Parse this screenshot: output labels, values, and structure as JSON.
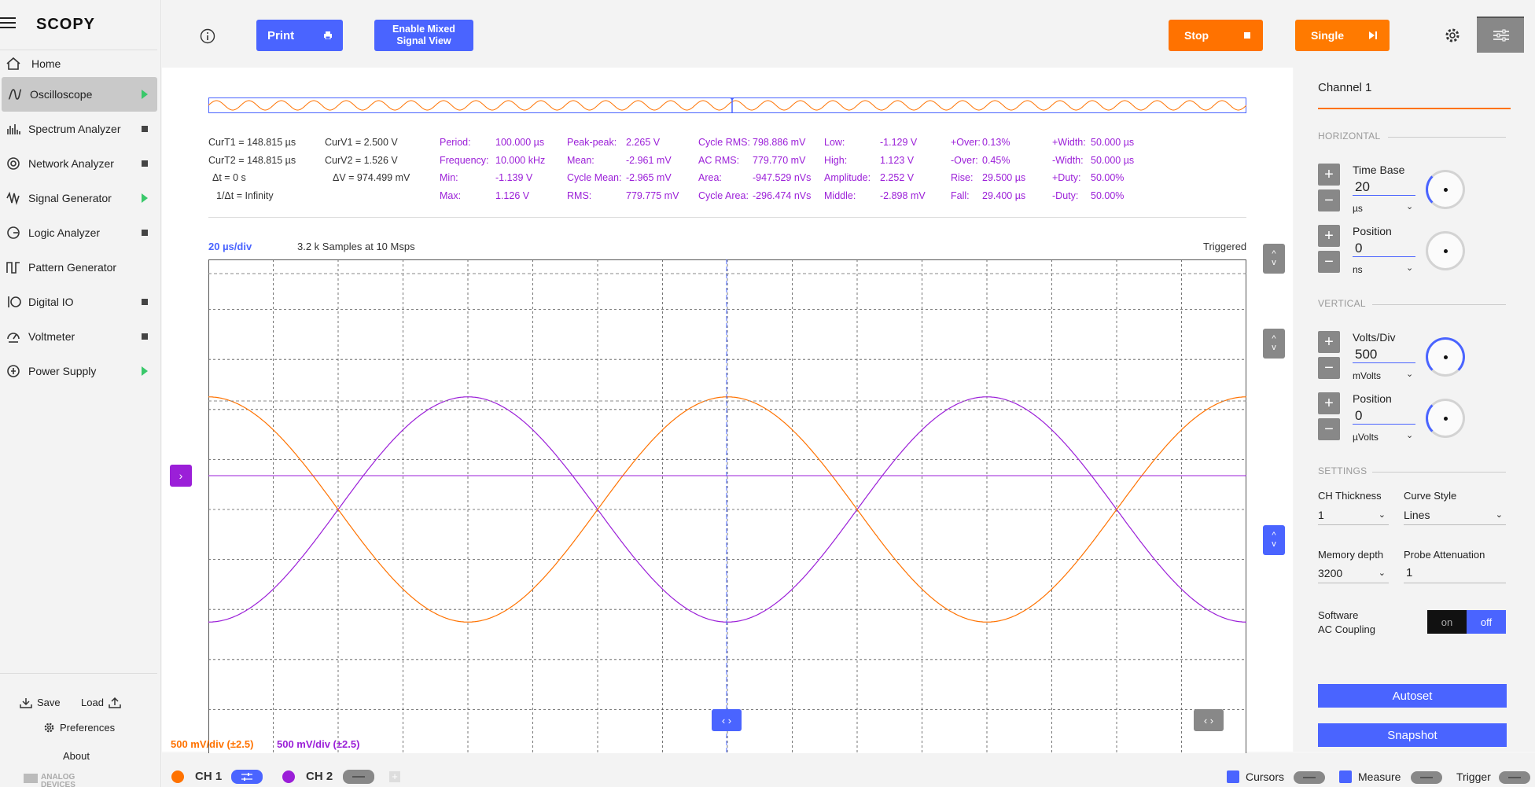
{
  "app": {
    "logo": "SCOPY"
  },
  "sidebar": {
    "items": [
      {
        "label": "Home",
        "icon": "home-icon",
        "status": "none"
      },
      {
        "label": "Oscilloscope",
        "icon": "oscilloscope-icon",
        "status": "running"
      },
      {
        "label": "Spectrum Analyzer",
        "icon": "spectrum-analyzer-icon",
        "status": "stopped"
      },
      {
        "label": "Network Analyzer",
        "icon": "network-analyzer-icon",
        "status": "stopped"
      },
      {
        "label": "Signal Generator",
        "icon": "signal-generator-icon",
        "status": "running"
      },
      {
        "label": "Logic Analyzer",
        "icon": "logic-analyzer-icon",
        "status": "stopped"
      },
      {
        "label": "Pattern Generator",
        "icon": "pattern-generator-icon",
        "status": "none"
      },
      {
        "label": "Digital IO",
        "icon": "digital-io-icon",
        "status": "stopped"
      },
      {
        "label": "Voltmeter",
        "icon": "voltmeter-icon",
        "status": "stopped"
      },
      {
        "label": "Power Supply",
        "icon": "power-supply-icon",
        "status": "running"
      }
    ],
    "save": "Save",
    "load": "Load",
    "preferences": "Preferences",
    "about": "About",
    "vendor_line1": "ANALOG",
    "vendor_line2": "DEVICES"
  },
  "toolbar": {
    "print": "Print",
    "mixed_line1": "Enable Mixed",
    "mixed_line2": "Signal View",
    "stop": "Stop",
    "single": "Single"
  },
  "plot": {
    "timebase_label": "20 µs/div",
    "samples_label": "3.2 k Samples at 10 Msps",
    "trigger_status": "Triggered",
    "ch1_scale": "500 mV/div (±2.5)",
    "ch2_scale": "500 mV/div (±2.5)",
    "cursors": {
      "curT1": "CurT1 = 148.815 µs",
      "curT2": "CurT2 = 148.815 µs",
      "dt": "Δt = 0 s",
      "inv_dt": "1/Δt = Infinity",
      "curV1": "CurV1 = 2.500 V",
      "curV2": "CurV2 = 1.526 V",
      "dv": "ΔV = 974.499 mV"
    },
    "measurements": [
      {
        "label": "Period:",
        "value": "100.000 µs"
      },
      {
        "label": "Frequency:",
        "value": "10.000 kHz"
      },
      {
        "label": "Min:",
        "value": "-1.139 V"
      },
      {
        "label": "Max:",
        "value": "1.126 V"
      },
      {
        "label": "Peak-peak:",
        "value": "2.265 V"
      },
      {
        "label": "Mean:",
        "value": "-2.961 mV"
      },
      {
        "label": "Cycle Mean:",
        "value": "-2.965 mV"
      },
      {
        "label": "RMS:",
        "value": "779.775 mV"
      },
      {
        "label": "Cycle RMS:",
        "value": "798.886 mV"
      },
      {
        "label": "AC RMS:",
        "value": "779.770 mV"
      },
      {
        "label": "Area:",
        "value": "-947.529 nVs"
      },
      {
        "label": "Cycle Area:",
        "value": "-296.474 nVs"
      },
      {
        "label": "Low:",
        "value": "-1.129 V"
      },
      {
        "label": "High:",
        "value": "1.123 V"
      },
      {
        "label": "Amplitude:",
        "value": "2.252 V"
      },
      {
        "label": "Middle:",
        "value": "-2.898 mV"
      },
      {
        "label": "+Over:",
        "value": "0.13%"
      },
      {
        "label": "-Over:",
        "value": "0.45%"
      },
      {
        "label": "Rise:",
        "value": "29.500 µs"
      },
      {
        "label": "Fall:",
        "value": "29.400 µs"
      },
      {
        "label": "+Width:",
        "value": "50.000 µs"
      },
      {
        "label": "-Width:",
        "value": "50.000 µs"
      },
      {
        "label": "+Duty:",
        "value": "50.00%"
      },
      {
        "label": "-Duty:",
        "value": "50.00%"
      }
    ]
  },
  "channels": {
    "ch1": {
      "label": "CH 1",
      "color": "#ff7200"
    },
    "ch2": {
      "label": "CH 2",
      "color": "#9b1fd8"
    }
  },
  "bottom": {
    "cursors": "Cursors",
    "measure": "Measure",
    "trigger": "Trigger"
  },
  "panel": {
    "title": "Channel 1",
    "horizontal": "HORIZONTAL",
    "timebase": {
      "label": "Time Base",
      "value": "20",
      "unit": "µs"
    },
    "hposition": {
      "label": "Position",
      "value": "0",
      "unit": "ns"
    },
    "vertical": "VERTICAL",
    "voltsdiv": {
      "label": "Volts/Div",
      "value": "500",
      "unit": "mVolts"
    },
    "vposition": {
      "label": "Position",
      "value": "0",
      "unit": "µVolts"
    },
    "settings": "SETTINGS",
    "ch_thickness": {
      "label": "CH Thickness",
      "value": "1"
    },
    "curve_style": {
      "label": "Curve Style",
      "value": "Lines"
    },
    "memory_depth": {
      "label": "Memory depth",
      "value": "3200"
    },
    "probe_attenuation": {
      "label": "Probe Attenuation",
      "value": "1"
    },
    "ac_coupling": {
      "line1": "Software",
      "line2": "AC Coupling",
      "on": "on",
      "off": "off",
      "state": "off"
    },
    "autoset": "Autoset",
    "snapshot": "Snapshot"
  },
  "chart_data": {
    "type": "line",
    "xlabel": "",
    "ylabel": "",
    "x_range_us": [
      0,
      200
    ],
    "ylim_v": [
      -2.5,
      2.5
    ],
    "series": [
      {
        "name": "CH 1",
        "color": "#ff7200",
        "amplitude_v": 1.126,
        "frequency_khz": 10,
        "phase_deg": 90
      },
      {
        "name": "CH 2",
        "color": "#9b1fd8",
        "amplitude_v": 1.126,
        "frequency_khz": 10,
        "phase_deg": -90
      }
    ]
  }
}
